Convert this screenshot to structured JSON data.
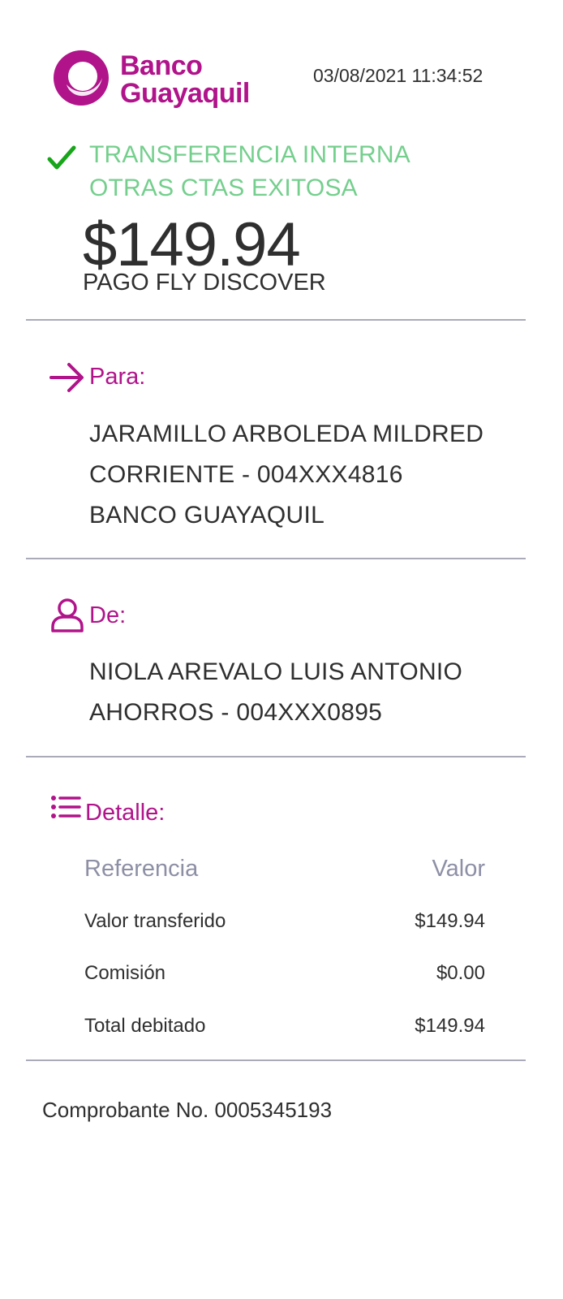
{
  "header": {
    "bank_name_line1": "Banco",
    "bank_name_line2": "Guayaquil",
    "timestamp": "03/08/2021 11:34:52"
  },
  "status": {
    "line1": "TRANSFERENCIA INTERNA",
    "line2": "OTRAS CTAS EXITOSA"
  },
  "amount": "$149.94",
  "concept": "PAGO FLY DISCOVER",
  "to": {
    "title": "Para:",
    "name": "JARAMILLO ARBOLEDA MILDRED",
    "account": "CORRIENTE - 004XXX4816",
    "bank": "BANCO GUAYAQUIL"
  },
  "from": {
    "title": "De:",
    "name": "NIOLA AREVALO LUIS ANTONIO",
    "account": "AHORROS - 004XXX0895"
  },
  "details": {
    "title": "Detalle:",
    "col_reference": "Referencia",
    "col_value": "Valor",
    "rows": [
      {
        "label": "Valor transferido",
        "value": "$149.94"
      },
      {
        "label": "Comisión",
        "value": "$0.00"
      },
      {
        "label": "Total debitado",
        "value": "$149.94"
      }
    ]
  },
  "footer": {
    "receipt": "Comprobante No. 0005345193"
  },
  "colors": {
    "brand": "#b0138a",
    "success": "#74cf8d",
    "check": "#18a51a",
    "divider": "#a9abb9"
  },
  "icons": {
    "logo": "banco-guayaquil-logo",
    "status": "check-icon",
    "to": "arrow-right-icon",
    "from": "user-icon",
    "details": "list-icon"
  }
}
